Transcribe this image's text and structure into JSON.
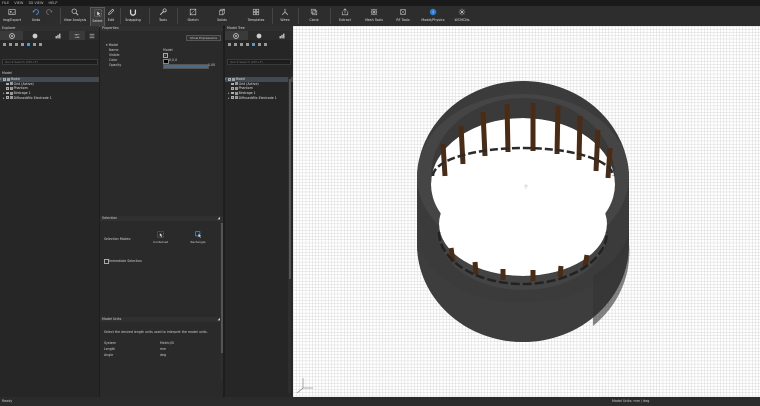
{
  "menu": [
    "FILE",
    "VIEW",
    "3D VIEW",
    "HELP"
  ],
  "ribbon": [
    {
      "label": "Img/Export",
      "icon": "image-export-icon"
    },
    {
      "label": "Undo",
      "icon": "undo-icon"
    },
    {
      "label": "",
      "icon": "redo-icon"
    },
    {
      "label": "View Analysis",
      "icon": "view-analysis-icon"
    },
    {
      "label": "Select",
      "icon": "select-icon"
    },
    {
      "label": "Edit",
      "icon": "edit-icon"
    },
    {
      "label": "Snapping",
      "icon": "snapping-icon"
    },
    {
      "label": "Tools",
      "icon": "tools-icon"
    },
    {
      "label": "Sketch",
      "icon": "sketch-icon"
    },
    {
      "label": "Solids",
      "icon": "solids-icon"
    },
    {
      "label": "Templates",
      "icon": "templates-icon"
    },
    {
      "label": "Wires",
      "icon": "wires-icon"
    },
    {
      "label": "Clone",
      "icon": "clone-icon"
    },
    {
      "label": "Extract",
      "icon": "extract-icon"
    },
    {
      "label": "Mesh Tools",
      "icon": "mesh-tools-icon"
    },
    {
      "label": "RF Tools",
      "icon": "rf-tools-icon"
    },
    {
      "label": "Model/Physics",
      "icon": "model-physics-icon"
    },
    {
      "label": "WCMCNs",
      "icon": "wcmcns-icon"
    }
  ],
  "explorer": {
    "title": "Explorer",
    "search_placeholder": "Quick Search (Ctrl+F)",
    "section": "Model",
    "tree": [
      {
        "label": "Model",
        "expand": "▾",
        "selected": true
      },
      {
        "label": "Grid (Active)",
        "expand": "",
        "selected": false
      },
      {
        "label": "Phantom",
        "expand": "",
        "selected": false
      },
      {
        "label": "Birdcage 1",
        "expand": "▸",
        "selected": false
      },
      {
        "label": "DiffusedWix Electrode 1",
        "expand": "▸",
        "selected": false
      }
    ]
  },
  "properties": {
    "title": "Properties",
    "show_expressions": "Show Expressions",
    "group": "Model",
    "rows": [
      {
        "label": "Name",
        "value": "Model"
      },
      {
        "label": "Visible",
        "value": "✓"
      },
      {
        "label": "Color",
        "value": "0,0,0"
      },
      {
        "label": "Opacity",
        "value": "1.00"
      }
    ],
    "selection": {
      "title": "Selection",
      "modes_label": "Selection Modes:",
      "mode1": "Contained",
      "mode2": "Rectangle",
      "immediate": "Immediate Selection"
    },
    "units": {
      "title": "Model Units",
      "desc": "Select the desired length units used to interpret the model units.",
      "rows": [
        {
          "label": "System",
          "value": "Metric/SI"
        },
        {
          "label": "Length",
          "value": "mm"
        },
        {
          "label": "Angle",
          "value": "deg"
        }
      ]
    }
  },
  "modeltree": {
    "title": "Model Tree",
    "search_placeholder": "Quick Search (Ctrl+F)",
    "tree": [
      {
        "label": "Model",
        "expand": "▾",
        "selected": true
      },
      {
        "label": "Grid (Active)",
        "expand": "",
        "selected": false
      },
      {
        "label": "Phantom",
        "expand": "",
        "selected": false
      },
      {
        "label": "Birdcage 1",
        "expand": "▸",
        "selected": false
      },
      {
        "label": "DiffusedWix Electrode 1",
        "expand": "▸",
        "selected": false
      }
    ]
  },
  "status": {
    "left": "Ready",
    "right": "Model Units: mm / deg"
  }
}
